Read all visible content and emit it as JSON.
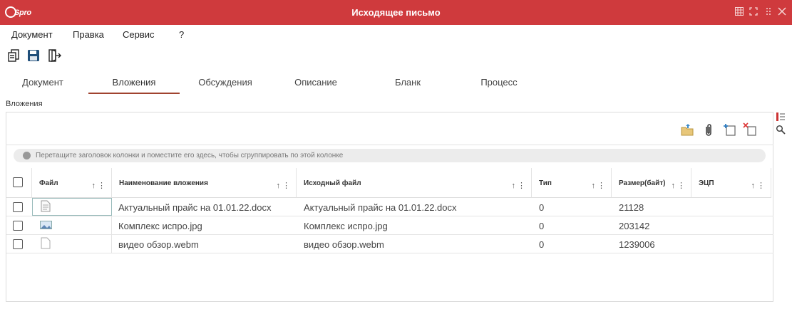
{
  "window": {
    "title": "Исходящее письмо",
    "logo": "Spro",
    "controls": [
      "grid-icon",
      "expand-icon",
      "drag-handle-icon",
      "close-icon"
    ]
  },
  "menu": [
    "Документ",
    "Правка",
    "Сервис",
    "?"
  ],
  "toolbar": {
    "icons": [
      "document-new-icon",
      "save-icon",
      "exit-icon"
    ]
  },
  "tabs": {
    "items": [
      "Документ",
      "Вложения",
      "Обсуждения",
      "Описание",
      "Бланк",
      "Процесс"
    ],
    "active": "Вложения"
  },
  "section": {
    "label": "Вложения"
  },
  "actions": [
    "folder-upload-icon",
    "paperclip-icon",
    "add-attachment-icon",
    "delete-attachment-icon"
  ],
  "group_hint": "Перетащите заголовок колонки и поместите его здесь, чтобы сгруппировать по этой колонке",
  "table": {
    "columns": [
      "Файл",
      "Наименование вложения",
      "Исходный файл",
      "Тип",
      "Размер(байт)",
      "ЭЦП"
    ],
    "rows": [
      {
        "icon": "document-file-icon",
        "name": "Актуальный прайс на 01.01.22.docx",
        "source": "Актуальный прайс на 01.01.22.docx",
        "type": "0",
        "size": "21128",
        "sig": ""
      },
      {
        "icon": "image-file-icon",
        "name": "Комплекс испро.jpg",
        "source": "Комплекс испро.jpg",
        "type": "0",
        "size": "203142",
        "sig": ""
      },
      {
        "icon": "blank-file-icon",
        "name": "видео обзор.webm",
        "source": "видео обзор.webm",
        "type": "0",
        "size": "1239006",
        "sig": ""
      }
    ]
  },
  "colors": {
    "titlebar": "#cf3a3d",
    "tab_underline": "#a0432f",
    "save_icon": "#1f4e79"
  }
}
